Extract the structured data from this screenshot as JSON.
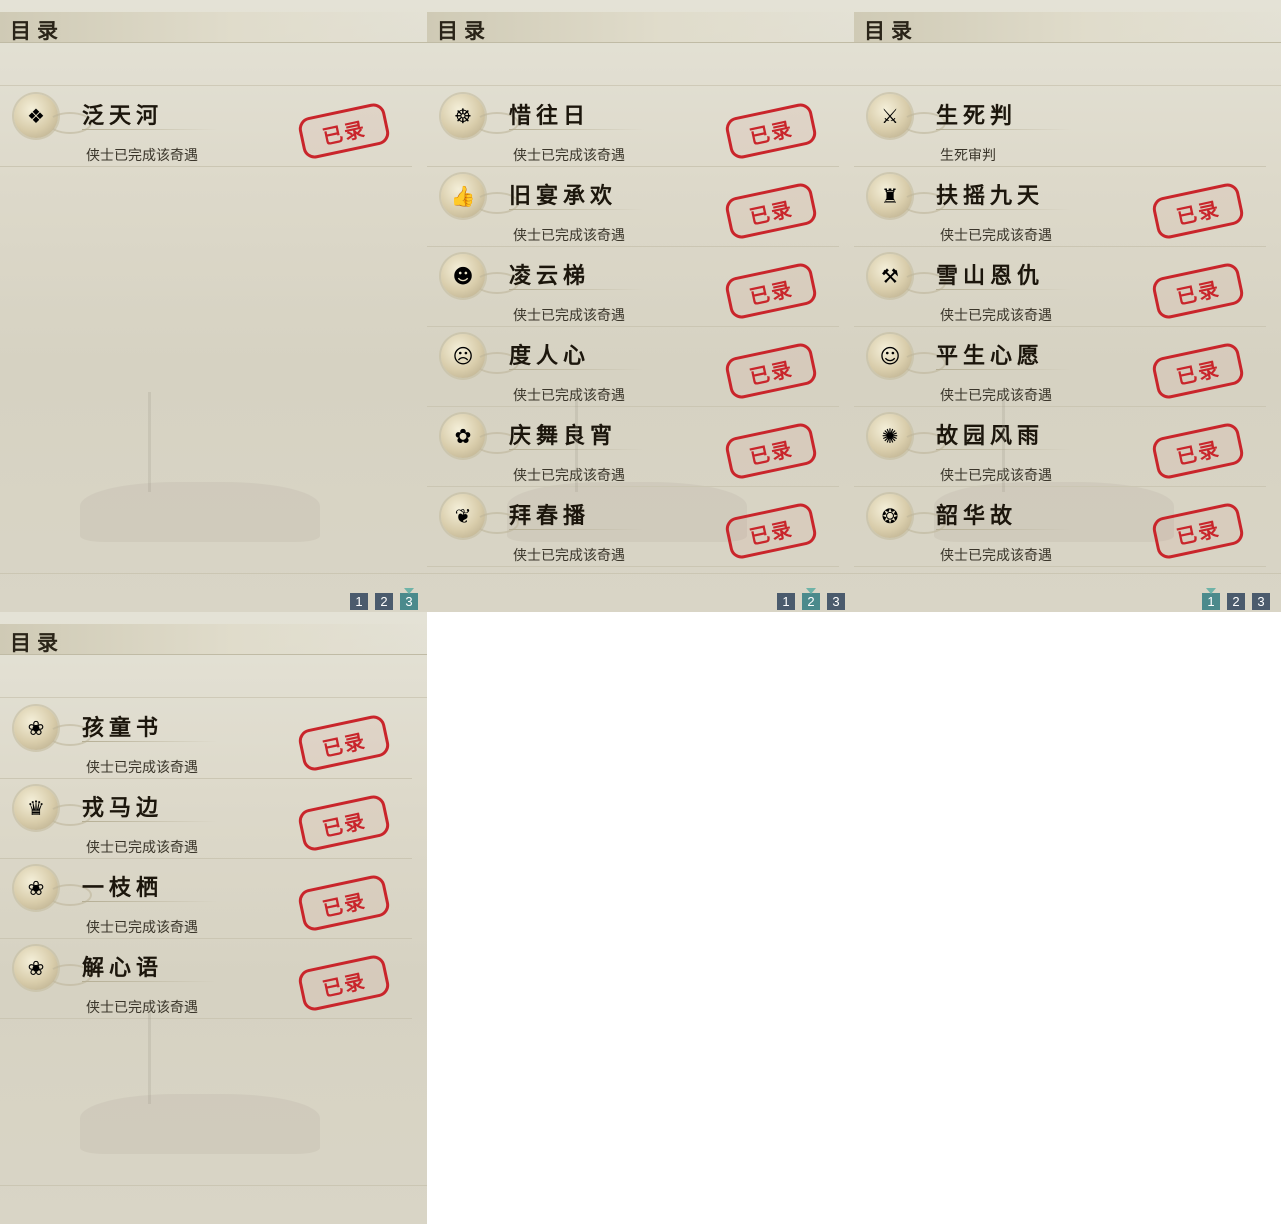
{
  "panels": [
    {
      "title": "目录",
      "entries": [
        {
          "name": "泛天河",
          "status": "侠士已完成该奇遇",
          "icon": "jade-ornament-icon",
          "icon_glyph": "❖",
          "stamp": "已录"
        }
      ],
      "pages": [
        "1",
        "2",
        "3"
      ],
      "active_page": "3"
    },
    {
      "title": "目录",
      "entries": [
        {
          "name": "惜往日",
          "status": "侠士已完成该奇遇",
          "icon": "golden-buddha-icon",
          "icon_glyph": "☸",
          "stamp": "已录"
        },
        {
          "name": "旧宴承欢",
          "status": "侠士已完成该奇遇",
          "icon": "thumbs-up-icon",
          "icon_glyph": "👍",
          "stamp": "已录"
        },
        {
          "name": "凌云梯",
          "status": "侠士已完成该奇遇",
          "icon": "monkey-face-icon",
          "icon_glyph": "☻",
          "stamp": "已录"
        },
        {
          "name": "度人心",
          "status": "侠士已完成该奇遇",
          "icon": "mask-icon",
          "icon_glyph": "☹",
          "stamp": "已录"
        },
        {
          "name": "庆舞良宵",
          "status": "侠士已完成该奇遇",
          "icon": "lion-dance-icon",
          "icon_glyph": "✿",
          "stamp": "已录"
        },
        {
          "name": "拜春播",
          "status": "侠士已完成该奇遇",
          "icon": "rabbit-icon",
          "icon_glyph": "❦",
          "stamp": "已录"
        }
      ],
      "pages": [
        "1",
        "2",
        "3"
      ],
      "active_page": "2"
    },
    {
      "title": "目录",
      "entries": [
        {
          "name": "生死判",
          "status": "生死审判",
          "icon": "sword-and-gold-icon",
          "icon_glyph": "⚔",
          "stamp": ""
        },
        {
          "name": "扶摇九天",
          "status": "侠士已完成该奇遇",
          "icon": "training-dummy-icon",
          "icon_glyph": "♜",
          "stamp": "已录"
        },
        {
          "name": "雪山恩仇",
          "status": "侠士已完成该奇遇",
          "icon": "crossed-weapons-icon",
          "icon_glyph": "⚒",
          "stamp": "已录"
        },
        {
          "name": "平生心愿",
          "status": "侠士已完成该奇遇",
          "icon": "scholar-figure-icon",
          "icon_glyph": "☺",
          "stamp": "已录"
        },
        {
          "name": "故园风雨",
          "status": "侠士已完成该奇遇",
          "icon": "fan-icon",
          "icon_glyph": "✺",
          "stamp": "已录"
        },
        {
          "name": "韶华故",
          "status": "侠士已完成该奇遇",
          "icon": "jade-dragon-icon",
          "icon_glyph": "❂",
          "stamp": "已录"
        }
      ],
      "pages": [
        "1",
        "2",
        "3"
      ],
      "active_page": "1"
    },
    {
      "title": "目录",
      "entries": [
        {
          "name": "孩童书",
          "status": "侠士已完成该奇遇",
          "icon": "cat-face-icon",
          "icon_glyph": "❀",
          "stamp": "已录"
        },
        {
          "name": "戎马边",
          "status": "侠士已完成该奇遇",
          "icon": "lady-portrait-icon",
          "icon_glyph": "♛",
          "stamp": "已录"
        },
        {
          "name": "一枝栖",
          "status": "侠士已完成该奇遇",
          "icon": "cat-face-icon",
          "icon_glyph": "❀",
          "stamp": "已录"
        },
        {
          "name": "解心语",
          "status": "侠士已完成该奇遇",
          "icon": "cat-face-icon",
          "icon_glyph": "❀",
          "stamp": "已录"
        }
      ],
      "pages": [],
      "active_page": ""
    }
  ],
  "colors": {
    "stamp_red": "#c9252b",
    "page_button": "#4b5b6d",
    "page_button_active": "#4b8a8c"
  }
}
